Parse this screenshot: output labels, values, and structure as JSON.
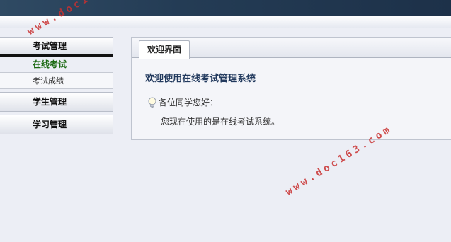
{
  "sidebar": {
    "menu1_label": "考试管理",
    "menu1_current": "在线考试",
    "menu1_sub": "考试成绩",
    "menu2_label": "学生管理",
    "menu3_label": "学习管理"
  },
  "tab": {
    "label": "欢迎界面"
  },
  "main": {
    "title": "欢迎使用在线考试管理系统",
    "greeting": "各位同学您好：",
    "message": "您现在使用的是在线考试系统。"
  },
  "watermark": {
    "text": "www.doc163.com"
  },
  "colors": {
    "accent": "#223a5e",
    "current_item": "#1b6a12",
    "watermark": "#c93030"
  },
  "icons": {
    "greeting": "lightbulb-icon"
  }
}
